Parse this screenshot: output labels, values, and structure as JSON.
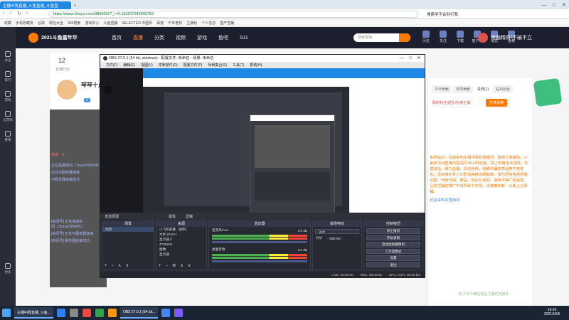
{
  "browser": {
    "tabs": [
      {
        "label": "主播叫我直播_斗鱼直播_斗鱼直",
        "active": true
      },
      {
        "label": "新标签页",
        "active": false
      }
    ],
    "url": "https://www.douyu.com/3869051?_r=0.168217342993759",
    "right_search": "搜索学不会别打我",
    "bookmarks": [
      "收藏",
      "手机收藏夹",
      "谷歌",
      "网址大全",
      "360搜索",
      "游戏中心",
      "斗鱼直播",
      "SELECTED 中国页",
      "百度",
      "千年老妖",
      "主播玩",
      "个人信息",
      "国产直播"
    ]
  },
  "douyu_header": {
    "logo_text": "2021斗鱼嘉年华",
    "nav": [
      "首页",
      "直播",
      "分类",
      "视频",
      "游戏",
      "鱼吧",
      "S11"
    ],
    "search_placeholder": "搜索直播",
    "icons": [
      "历史",
      "关注",
      "下载",
      "客户端",
      "消息",
      "鱼粮"
    ],
    "user_slogan": "骨骼精奇/不破不立"
  },
  "left_sidebar": [
    "关注",
    "排行",
    "游戏",
    "云游戏",
    "赛事",
    "更多"
  ],
  "room": {
    "title": "琴琴十点",
    "level": "12",
    "sub": "直播开启",
    "chat_lines": [
      "热度：0",
      "正在连接房间...Douyu/3869051",
      "正在与服务器连接",
      "与服务器连接成功",
      "[房间号] 正在连接房间...Douyu/3869051",
      "[房间号] 正在与服务器连接",
      "[房间号] 服务器连接成功"
    ]
  },
  "obs": {
    "title": "OBS 27.0.1 (64 bit, windows) - 配置文件: 未命名 - 场景: 未命名",
    "menu": [
      "文件(F)",
      "编辑(E)",
      "视图(V)",
      "停靠部件(D)",
      "配置文件(P)",
      "场景集合(S)",
      "工具(T)",
      "帮助(H)"
    ],
    "preview_label": "未选择源",
    "properties_btn": "属性",
    "filters_btn": "滤镜",
    "docks": {
      "scenes_title": "场景",
      "scene_item": "场景",
      "sources_title": "来源",
      "sources": [
        "小飞机屏幕（录制）",
        "文本 (GDI+)",
        "显示器 2",
        "4709919",
        "图像",
        "显示器"
      ],
      "mixer_title": "混音器",
      "mixer": [
        {
          "name": "桌面音频",
          "db": "0.0 dB"
        },
        {
          "name": "麦克风/Aux",
          "db": "0.0 dB"
        }
      ],
      "transitions_title": "转场特效",
      "transition_type": "淡出",
      "duration_label": "时长",
      "duration_value": "300 ms",
      "controls_title": "控制按钮",
      "controls": [
        "停止推流",
        "开始录制",
        "启动虚拟摄像机",
        "工作室模式",
        "设置",
        "退出"
      ]
    },
    "status": {
      "live": "LIVE: 00:00:00",
      "rec": "REC: 00:00:00",
      "cpu": "CPU: 0.0%, 60.00 fps"
    }
  },
  "right_panel": {
    "tabs": [
      "今日贡献",
      "本周贡献",
      "贵宾(1)",
      "钻石粉丝"
    ],
    "fan_btn": "开通贵族",
    "chat_header": "贵族/粉丝/送礼/礼用主播",
    "system_message": "系统提示：欢迎来到主播叫我的直播间。直播分享鼓励，斗鱼依法对直播内容进行24小时巡查，禁止传播违法违规、封建迷信、暴力血腥、低俗色情、招嫖诈骗违禁品等不良信息。坚决维护青少年群体精神文明健康。请勿轻信各类招聘征婚、代练代抽、刷钻、购买礼包码、游戏币等广告信息，且如主播在推广中诱导私下交易，请谨慎判断，以免上当受骗。",
    "welcome": "欢迎来到本直播间",
    "footnote": "有了10个峰位职业之路的完美补"
  },
  "taskbar": {
    "apps": [
      "主播叫我直播_斗鱼...",
      "OBS 27.0.1 (64 bit..."
    ],
    "time": "10:03",
    "date": "2021/10/6"
  },
  "colors": {
    "douyu_orange": "#ff7a00",
    "obs_bg": "#2b2e38",
    "taskbar": "#1b2433",
    "accent_blue": "#1e88e5"
  }
}
